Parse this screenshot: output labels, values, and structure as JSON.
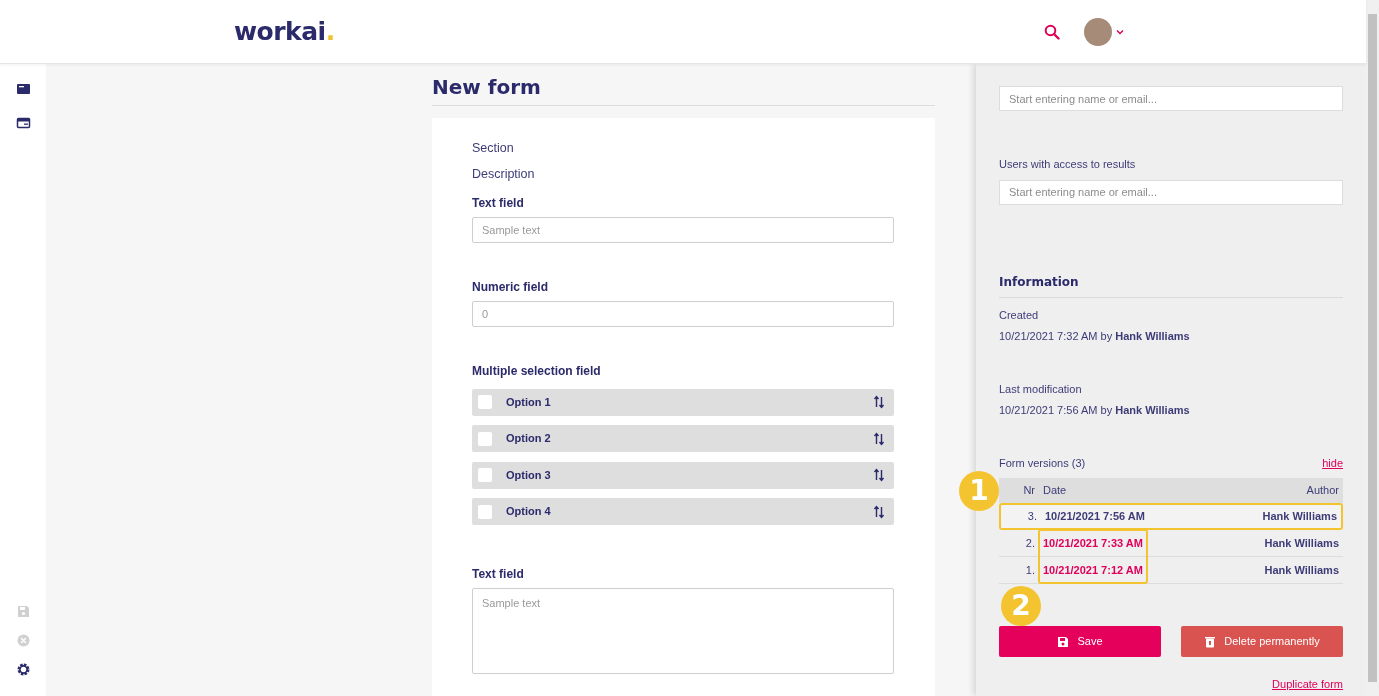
{
  "header": {
    "logo": {
      "text": "workai",
      "dot": "."
    }
  },
  "sidebar": {
    "items": [
      {
        "kind": "card",
        "disabled": false
      },
      {
        "kind": "window",
        "disabled": false
      }
    ],
    "bottom_items": [
      {
        "kind": "save",
        "disabled": true
      },
      {
        "kind": "cancel",
        "disabled": true
      },
      {
        "kind": "settings",
        "disabled": false
      }
    ]
  },
  "form": {
    "title": "New form",
    "section": "Section",
    "description": "Description",
    "fields": [
      {
        "kind": "text",
        "label": "Text field",
        "placeholder": "Sample text"
      },
      {
        "kind": "number",
        "label": "Numeric field",
        "placeholder": "0"
      },
      {
        "kind": "multi",
        "label": "Multiple selection field",
        "options": [
          {
            "label": "Option 1",
            "checked": false
          },
          {
            "label": "Option 2",
            "checked": false
          },
          {
            "label": "Option 3",
            "checked": false
          },
          {
            "label": "Option 4",
            "checked": false
          }
        ]
      },
      {
        "kind": "textarea",
        "label": "Text field",
        "placeholder": "Sample text"
      }
    ]
  },
  "panel": {
    "fields": [
      {
        "placeholder": "Start entering name or email..."
      },
      {
        "label": "Users with access to results",
        "placeholder": "Start entering name or email..."
      }
    ],
    "information": {
      "title": "Information",
      "items": [
        {
          "label": "Created",
          "value": "10/21/2021 7:32 AM by **Hank Williams**"
        },
        {
          "label": "Last modification",
          "value": "10/21/2021 7:56 AM by **Hank Williams**"
        }
      ]
    },
    "versions": {
      "annotation": "1",
      "title": "Form versions (3)",
      "toggle": "hide",
      "columns": [
        "Nr",
        "Date",
        "Author"
      ],
      "rows": [
        {
          "nr": "3.",
          "date": "10/21/2021 7:56 AM",
          "author": "Hank Williams",
          "current": true,
          "row_highlighted": true,
          "date_highlighted": false
        },
        {
          "nr": "2.",
          "date": "10/21/2021 7:33 AM",
          "author": "Hank Williams",
          "current": false,
          "row_highlighted": false,
          "date_highlighted": true
        },
        {
          "nr": "1.",
          "date": "10/21/2021 7:12 AM",
          "author": "Hank Williams",
          "current": false,
          "row_highlighted": false,
          "date_highlighted": true
        }
      ]
    },
    "buttons_annotation": "2",
    "buttons": [
      {
        "kind": "save",
        "label": "Save"
      },
      {
        "kind": "delete",
        "label": "Delete permanently"
      }
    ],
    "duplicate": "Duplicate form"
  }
}
